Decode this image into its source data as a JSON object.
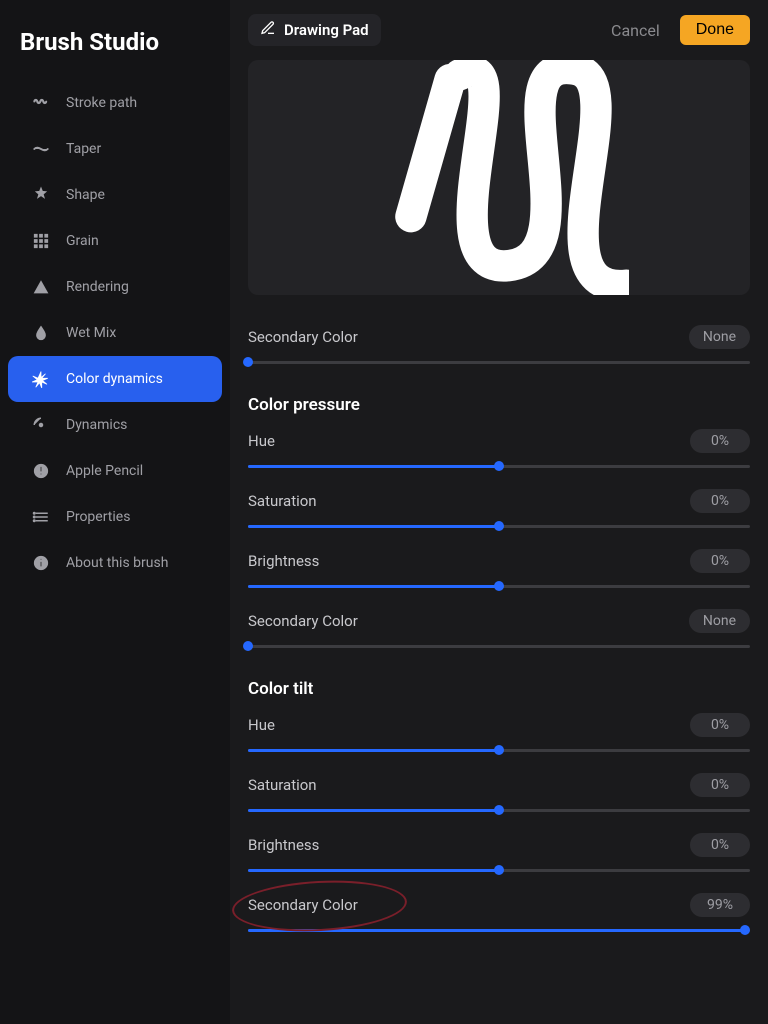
{
  "app_title": "Brush Studio",
  "header": {
    "title": "Drawing Pad",
    "cancel": "Cancel",
    "done": "Done"
  },
  "sidebar": {
    "items": [
      {
        "id": "stroke-path",
        "label": "Stroke path"
      },
      {
        "id": "taper",
        "label": "Taper"
      },
      {
        "id": "shape",
        "label": "Shape"
      },
      {
        "id": "grain",
        "label": "Grain"
      },
      {
        "id": "rendering",
        "label": "Rendering"
      },
      {
        "id": "wet-mix",
        "label": "Wet Mix"
      },
      {
        "id": "color-dynamics",
        "label": "Color dynamics",
        "active": true
      },
      {
        "id": "dynamics",
        "label": "Dynamics"
      },
      {
        "id": "apple-pencil",
        "label": "Apple Pencil"
      },
      {
        "id": "properties",
        "label": "Properties"
      },
      {
        "id": "about",
        "label": "About this brush"
      }
    ]
  },
  "top_slider": {
    "label": "Secondary Color",
    "value": "None",
    "percent": 0
  },
  "sections": [
    {
      "title": "Color pressure",
      "sliders": [
        {
          "label": "Hue",
          "value": "0%",
          "percent": 50
        },
        {
          "label": "Saturation",
          "value": "0%",
          "percent": 50
        },
        {
          "label": "Brightness",
          "value": "0%",
          "percent": 50
        },
        {
          "label": "Secondary Color",
          "value": "None",
          "percent": 0
        }
      ]
    },
    {
      "title": "Color tilt",
      "sliders": [
        {
          "label": "Hue",
          "value": "0%",
          "percent": 50
        },
        {
          "label": "Saturation",
          "value": "0%",
          "percent": 50
        },
        {
          "label": "Brightness",
          "value": "0%",
          "percent": 50
        },
        {
          "label": "Secondary Color",
          "value": "99%",
          "percent": 99,
          "annotated": true
        }
      ]
    }
  ]
}
